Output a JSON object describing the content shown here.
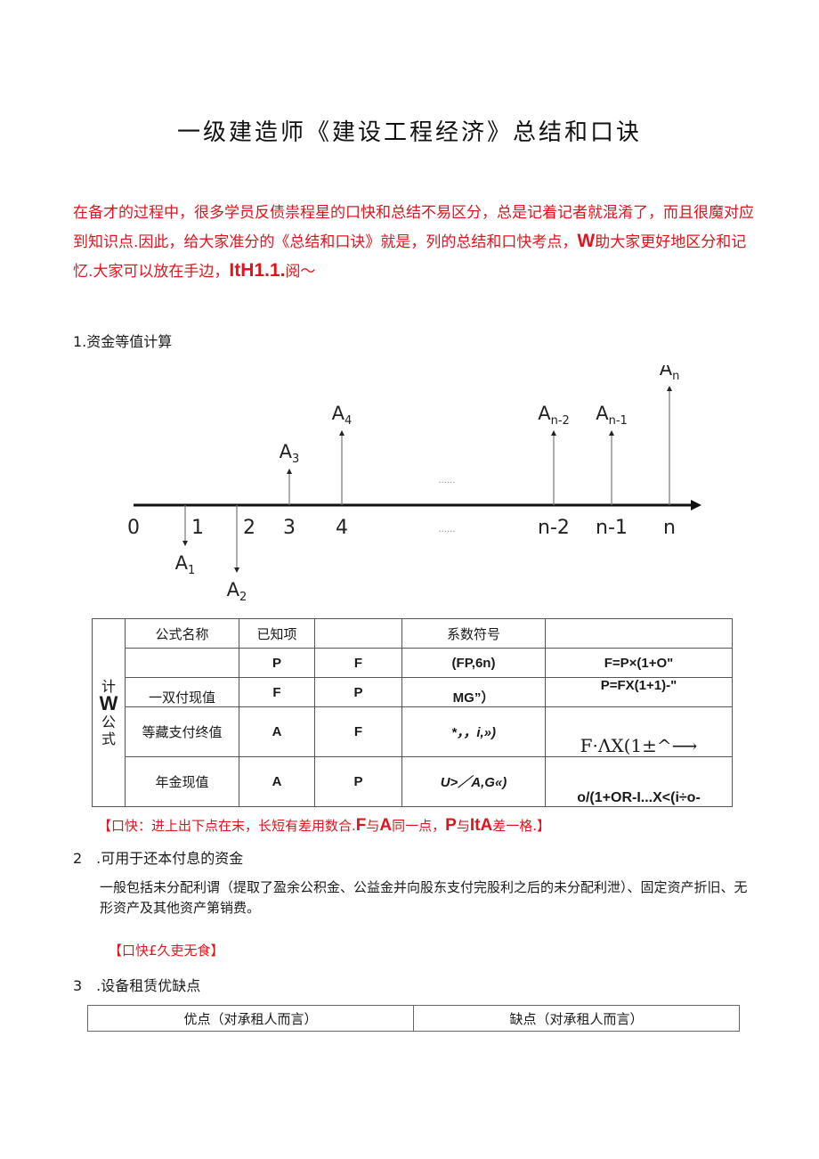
{
  "document": {
    "title": "一级建造师《建设工程经济》总结和口诀",
    "intro": {
      "part1": "在备才的过程中，很多学员反债祟程星的口快和总结不易区分，总是记着记者就混淆了，而且很魔对应到知识点.因此，给大家准分的《总结和口诀》就是，列的总结和口快考点，",
      "bold1": "W",
      "part2": "助大家更好地区分和记忆.大家可以放在手边，",
      "bold2": "ItH1.1.",
      "part3": "阅〜"
    },
    "color_accent": "#e0141e"
  },
  "section1": {
    "heading": "1.资金等值计算",
    "timeline": {
      "ticks": [
        "0",
        "1",
        "2",
        "3",
        "4",
        "n-2",
        "n-1",
        "n"
      ],
      "ellipsis": "······",
      "flows": [
        {
          "label": "A",
          "sub": "1",
          "direction": "down"
        },
        {
          "label": "A",
          "sub": "2",
          "direction": "down"
        },
        {
          "label": "A",
          "sub": "3",
          "direction": "up"
        },
        {
          "label": "A",
          "sub": "4",
          "direction": "up"
        },
        {
          "label": "A",
          "sub": "n-2",
          "direction": "up"
        },
        {
          "label": "A",
          "sub": "n-1",
          "direction": "up"
        },
        {
          "label": "A",
          "sub": "n",
          "direction": "up"
        }
      ]
    },
    "table": {
      "side_label": {
        "top": "计",
        "bold": "W",
        "bottom1": "公",
        "bottom2": "式"
      },
      "headers": [
        "公式名称",
        "已知项",
        "",
        "系数符号",
        ""
      ],
      "rows": [
        {
          "name": "",
          "known": "P",
          "target": "F",
          "symbol": "(FP,6n)",
          "formula": "F=P×(1+O\""
        },
        {
          "name": "一双付现值",
          "known": "F",
          "target": "P",
          "symbol": "MG”）",
          "formula": "P=FX(1+1)-\""
        },
        {
          "name": "等藏支付终值",
          "known": "A",
          "target": "F",
          "symbol": "*，，i,»)",
          "formula": "F·ΛX(1±^⟶"
        },
        {
          "name": "年金现值",
          "known": "A",
          "target": "P",
          "symbol": "U>／A,G«)",
          "formula": "o/(1+OR-I...X<(i÷o-"
        }
      ]
    },
    "tip": {
      "part1": "【口快：进上出下点在末，长短有差用数合.",
      "b1": "F",
      "p2": "与",
      "b2": "A",
      "p3": "同一点，",
      "b3": "P",
      "p4": "与",
      "b4": "ItA",
      "p5": "差一格.】"
    }
  },
  "section2": {
    "heading": "2　.可用于还本付息的资金",
    "paragraph": "一般包括未分配利谓（提取了盈余公积金、公益金并向股东支付完股利之后的未分配利泄）、固定资产折旧、无形资产及其他资产第销费。",
    "tip": "【口快£久吏无食】"
  },
  "section3": {
    "heading": "3　.设备租赁优缺点",
    "table_headers": [
      "优点（对承租人而言）",
      "缺点（对承租人而言）"
    ]
  }
}
